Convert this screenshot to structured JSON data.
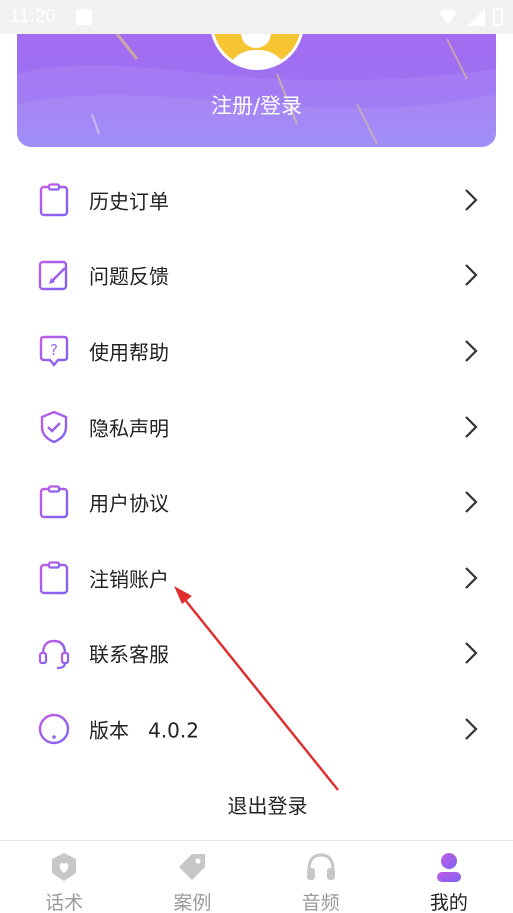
{
  "status_bar": {
    "time": "11:20"
  },
  "header": {
    "login_label": "注册/登录"
  },
  "menu": [
    {
      "label": "历史订单",
      "icon": "clipboard-list-icon"
    },
    {
      "label": "问题反馈",
      "icon": "edit-icon"
    },
    {
      "label": "使用帮助",
      "icon": "help-chat-icon"
    },
    {
      "label": "隐私声明",
      "icon": "shield-check-icon"
    },
    {
      "label": "用户协议",
      "icon": "clipboard-list-icon"
    },
    {
      "label": "注销账户",
      "icon": "clipboard-list-icon"
    },
    {
      "label": "联系客服",
      "icon": "headset-icon"
    },
    {
      "label": "版本   4.0.2",
      "icon": "info-alert-icon"
    }
  ],
  "logout_label": "退出登录",
  "tabs": [
    {
      "label": "话术",
      "icon": "shield-heart-icon",
      "active": false
    },
    {
      "label": "案例",
      "icon": "tag-icon",
      "active": false
    },
    {
      "label": "音频",
      "icon": "headphones-icon",
      "active": false
    },
    {
      "label": "我的",
      "icon": "user-icon",
      "active": true
    }
  ],
  "colors": {
    "accent": "#9b6cf2",
    "icon_gradient_start": "#c25ce6",
    "icon_gradient_end": "#7d63f0",
    "annotation": "#e02b2b"
  }
}
